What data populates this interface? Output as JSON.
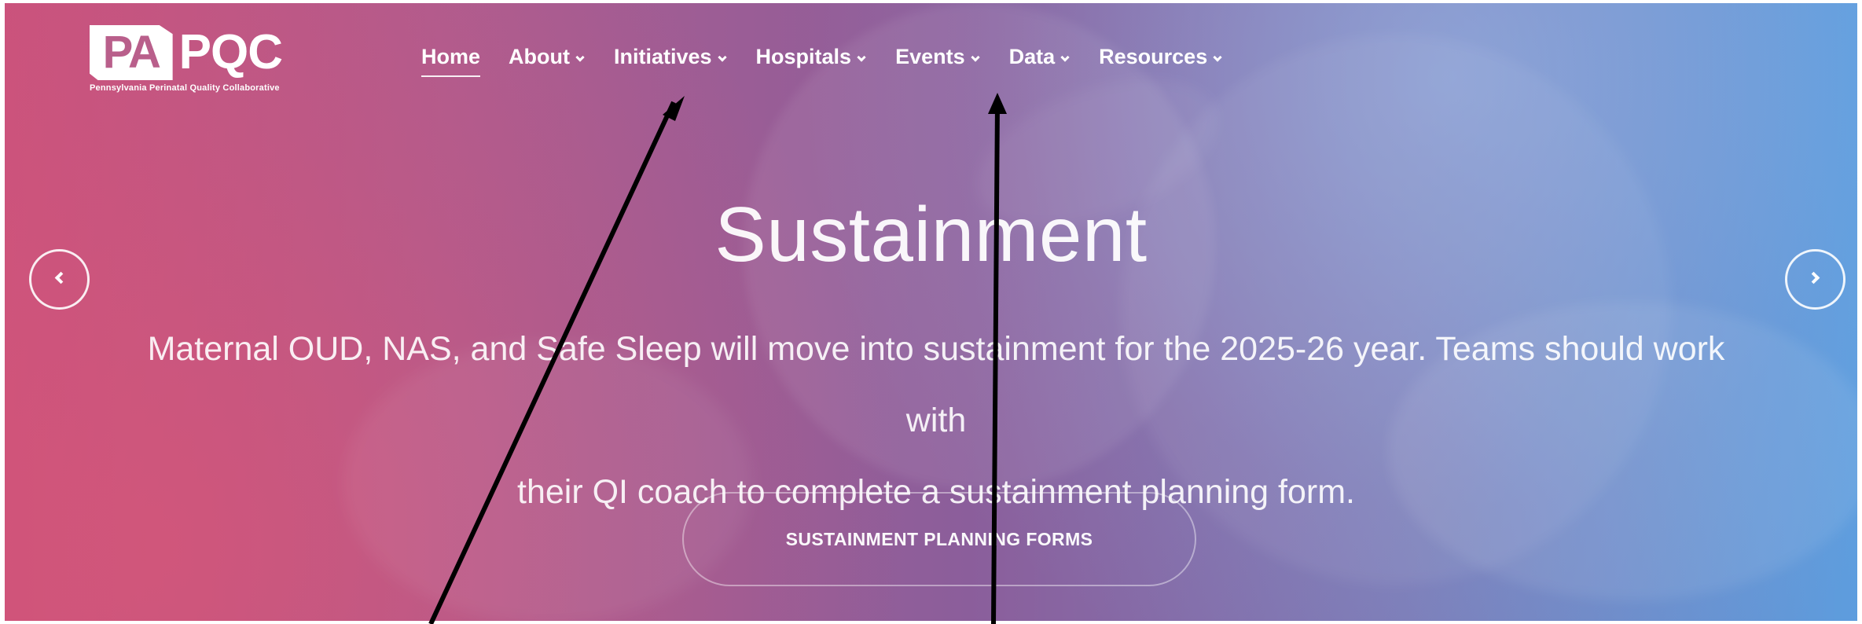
{
  "brand": {
    "logo_pa": "PA",
    "logo_pqc": "PQC",
    "logo_subtitle": "Pennsylvania Perinatal Quality Collaborative"
  },
  "nav": {
    "items": [
      {
        "label": "Home",
        "active": true,
        "has_dropdown": false
      },
      {
        "label": "About",
        "active": false,
        "has_dropdown": true
      },
      {
        "label": "Initiatives",
        "active": false,
        "has_dropdown": true
      },
      {
        "label": "Hospitals",
        "active": false,
        "has_dropdown": true
      },
      {
        "label": "Events",
        "active": false,
        "has_dropdown": true
      },
      {
        "label": "Data",
        "active": false,
        "has_dropdown": true
      },
      {
        "label": "Resources",
        "active": false,
        "has_dropdown": true
      }
    ]
  },
  "hero": {
    "title": "Sustainment",
    "body_line_1": "Maternal OUD, NAS, and Safe Sleep will move into sustainment for the 2025-26 year. Teams should work with",
    "body_line_2": "their QI coach to complete a sustainment planning form.",
    "cta_label": "SUSTAINMENT PLANNING FORMS"
  },
  "carousel": {
    "prev_icon": "chevron-left-icon",
    "next_icon": "chevron-right-icon"
  },
  "colors": {
    "hero_start": "#c9527d",
    "hero_mid": "#8b5e9b",
    "hero_end": "#5d9dde",
    "text": "#ffffff",
    "annotation": "#000000"
  }
}
